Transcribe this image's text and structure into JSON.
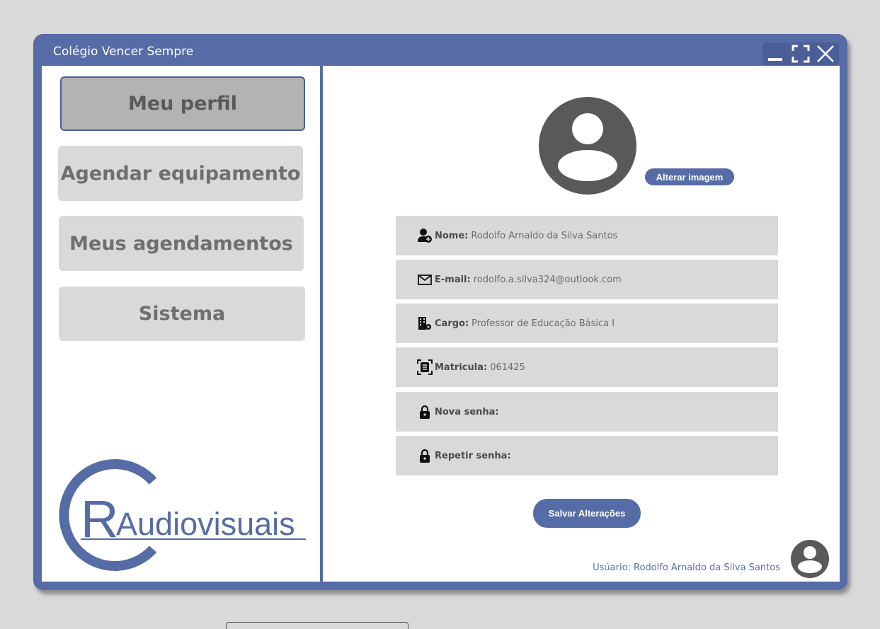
{
  "window": {
    "title": "Colégio Vencer Sempre",
    "controls": [
      "minimize-icon",
      "maximize-icon",
      "close-icon"
    ]
  },
  "sidebar": {
    "items": [
      {
        "label": "Meu perfil",
        "active": true
      },
      {
        "label": "Agendar equipamento",
        "active": false
      },
      {
        "label": "Meus agendamentos",
        "active": false
      },
      {
        "label": "Sistema",
        "active": false
      }
    ],
    "logo": {
      "initials": "CR",
      "text": "Audiovisuais"
    }
  },
  "profile": {
    "change_image_label": "Alterar imagem",
    "fields": [
      {
        "icon": "user-add-icon",
        "label": "Nome:",
        "value": "Rodolfo Arnaldo da Silva Santos"
      },
      {
        "icon": "envelope-icon",
        "label": "E-mail:",
        "value": "rodolfo.a.silva324@outlook.com"
      },
      {
        "icon": "building-gear-icon",
        "label": "Cargo:",
        "value": "Professor de Educação Básica I"
      },
      {
        "icon": "id-scan-icon",
        "label": "Matricula:",
        "value": "061425"
      },
      {
        "icon": "lock-icon",
        "label": "Nova senha:",
        "value": ""
      },
      {
        "icon": "lock-icon",
        "label": "Repetir senha:",
        "value": ""
      }
    ],
    "save_label": "Salvar Alterações"
  },
  "footer": {
    "user_label": "Usúario: Rodolfo Arnaldo da Silva Santos"
  },
  "colors": {
    "accent": "#566ca6",
    "nav_bg": "#d9d9d9",
    "nav_active_bg": "#b3b3b3",
    "avatar": "#595959"
  }
}
